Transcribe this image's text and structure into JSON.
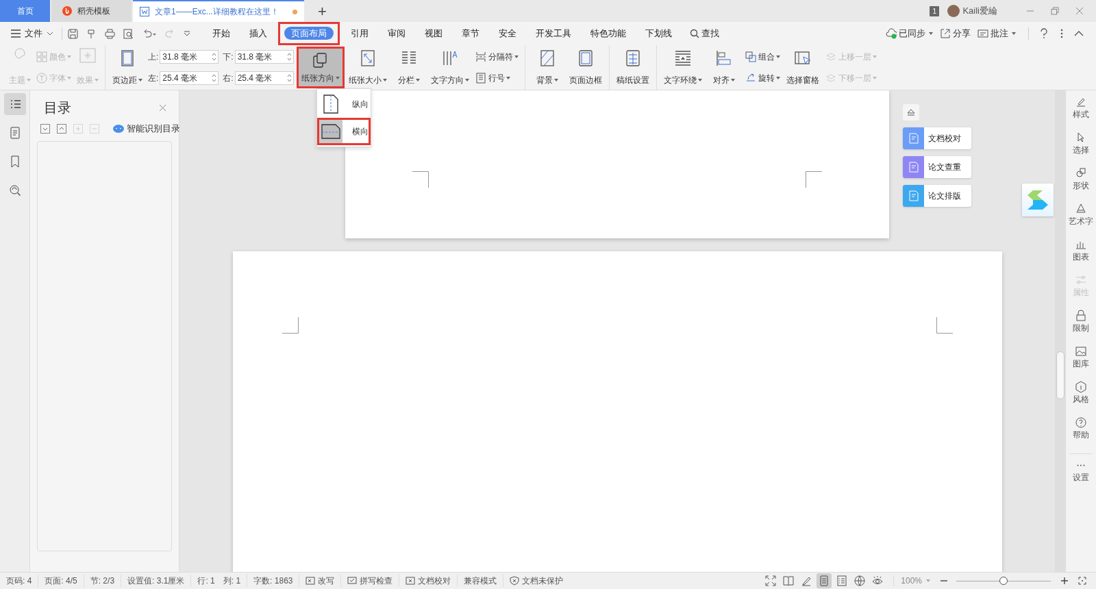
{
  "tabs": [
    {
      "kind": "home",
      "label": "首页",
      "selected": false
    },
    {
      "kind": "template",
      "label": "稻壳模板",
      "selected": false
    },
    {
      "kind": "document",
      "label": "文章1——Exc...详细教程在这里！",
      "selected": true,
      "modified": true
    }
  ],
  "titlebar": {
    "new_tab": "+",
    "badge": "1",
    "user": "Kaili爱綸"
  },
  "menu": {
    "file": "文件",
    "items": [
      {
        "label": "开始",
        "selected": false,
        "highlighted": false
      },
      {
        "label": "插入",
        "selected": false,
        "highlighted": false
      },
      {
        "label": "页面布局",
        "selected": true,
        "highlighted": true
      },
      {
        "label": "引用",
        "selected": false,
        "highlighted": false
      },
      {
        "label": "审阅",
        "selected": false,
        "highlighted": false
      },
      {
        "label": "视图",
        "selected": false,
        "highlighted": false
      },
      {
        "label": "章节",
        "selected": false,
        "highlighted": false
      },
      {
        "label": "安全",
        "selected": false,
        "highlighted": false
      },
      {
        "label": "开发工具",
        "selected": false,
        "highlighted": false
      },
      {
        "label": "特色功能",
        "selected": false,
        "highlighted": false
      },
      {
        "label": "下划线",
        "selected": false,
        "highlighted": false
      }
    ],
    "search": "查找",
    "right": [
      {
        "label": "已同步",
        "dropdown": true
      },
      {
        "label": "分享",
        "dropdown": false
      },
      {
        "label": "批注",
        "dropdown": true
      }
    ]
  },
  "ribbon": {
    "groups": [
      [
        {
          "kind": "stack",
          "items": [
            {
              "label": "主题",
              "dropdown": true,
              "disabled": true
            }
          ]
        },
        {
          "kind": "stack",
          "items": [
            {
              "label": "颜色",
              "dropdown": true,
              "disabled": true
            },
            {
              "label": "字体",
              "dropdown": true,
              "disabled": true
            }
          ]
        },
        {
          "kind": "stack",
          "items": [
            {
              "label": "效果",
              "dropdown": true,
              "disabled": true
            }
          ]
        }
      ],
      [
        {
          "kind": "large",
          "label": "页边距",
          "dropdown": true,
          "disabled": false,
          "active": false,
          "highlighted": false
        },
        {
          "kind": "fields",
          "items": [
            {
              "label": "上:",
              "value": "31.8 毫米"
            },
            {
              "label": "左:",
              "value": "25.4 毫米"
            }
          ]
        },
        {
          "kind": "fields",
          "items": [
            {
              "label": "下:",
              "value": "31.8 毫米"
            },
            {
              "label": "右:",
              "value": "25.4 毫米"
            }
          ]
        },
        {
          "kind": "large",
          "label": "纸张方向",
          "dropdown": true,
          "disabled": false,
          "active": true,
          "highlighted": true
        },
        {
          "kind": "large",
          "label": "纸张大小",
          "dropdown": true,
          "disabled": false,
          "active": false,
          "highlighted": false
        },
        {
          "kind": "large",
          "label": "分栏",
          "dropdown": true,
          "disabled": false,
          "active": false,
          "highlighted": false
        },
        {
          "kind": "large",
          "label": "文字方向",
          "dropdown": true,
          "disabled": false,
          "active": false,
          "highlighted": false
        },
        {
          "kind": "stack",
          "items": [
            {
              "label": "分隔符",
              "dropdown": true,
              "disabled": false
            },
            {
              "label": "行号",
              "dropdown": true,
              "disabled": false
            }
          ]
        }
      ],
      [
        {
          "kind": "large",
          "label": "背景",
          "dropdown": true,
          "disabled": false,
          "active": false,
          "highlighted": false
        },
        {
          "kind": "large",
          "label": "页面边框",
          "dropdown": false,
          "disabled": false,
          "active": false,
          "highlighted": false
        }
      ],
      [
        {
          "kind": "large",
          "label": "稿纸设置",
          "dropdown": false,
          "disabled": false,
          "active": false,
          "highlighted": false
        }
      ],
      [
        {
          "kind": "large",
          "label": "文字环绕",
          "dropdown": true,
          "disabled": false,
          "active": false,
          "highlighted": false
        },
        {
          "kind": "large",
          "label": "对齐",
          "dropdown": true,
          "disabled": false,
          "active": false,
          "highlighted": false
        },
        {
          "kind": "stack",
          "items": [
            {
              "label": "组合",
              "dropdown": true,
              "disabled": false
            },
            {
              "label": "旋转",
              "dropdown": true,
              "disabled": false
            }
          ]
        },
        {
          "kind": "large",
          "label": "选择窗格",
          "dropdown": false,
          "disabled": false,
          "active": false,
          "highlighted": false
        },
        {
          "kind": "stack",
          "items": [
            {
              "label": "上移一层",
              "dropdown": true,
              "disabled": true
            },
            {
              "label": "下移一层",
              "dropdown": true,
              "disabled": true
            }
          ]
        }
      ]
    ]
  },
  "orientation_menu": [
    {
      "label": "纵向",
      "selected": false,
      "highlighted": false
    },
    {
      "label": "横向",
      "selected": true,
      "highlighted": true
    }
  ],
  "left_strip": [
    {
      "selected": true
    },
    {
      "selected": false
    },
    {
      "selected": false
    },
    {
      "selected": false
    }
  ],
  "toc": {
    "title": "目录",
    "smart": "智能识别目录",
    "buttons": [
      {
        "disabled": false
      },
      {
        "disabled": false
      },
      {
        "disabled": true
      },
      {
        "disabled": true
      }
    ]
  },
  "float_tools": [
    {
      "label": "文档校对",
      "color": "#6b9cf7"
    },
    {
      "label": "论文查重",
      "color": "#8f86f5"
    },
    {
      "label": "论文排版",
      "color": "#3ea8ef"
    }
  ],
  "right_sidebar": [
    {
      "label": "样式",
      "disabled": false
    },
    {
      "label": "选择",
      "disabled": false
    },
    {
      "label": "形状",
      "disabled": false
    },
    {
      "label": "艺术字",
      "disabled": false
    },
    {
      "label": "图表",
      "disabled": false
    },
    {
      "label": "属性",
      "disabled": true
    },
    {
      "label": "限制",
      "disabled": false
    },
    {
      "label": "图库",
      "disabled": false
    },
    {
      "label": "风格",
      "disabled": false
    },
    {
      "label": "帮助",
      "disabled": false
    },
    {
      "label": "设置",
      "disabled": false
    }
  ],
  "status_bar": {
    "items": [
      {
        "kind": "text",
        "label": "页码: 4"
      },
      {
        "kind": "text",
        "label": "页面: 4/5"
      },
      {
        "kind": "text",
        "label": "节: 2/3"
      },
      {
        "kind": "text",
        "label": "设置值: 3.1厘米"
      },
      {
        "kind": "text",
        "label": "行: 1"
      },
      {
        "kind": "text",
        "label": "列: 1"
      },
      {
        "kind": "text",
        "label": "字数: 1863"
      },
      {
        "kind": "button",
        "label": "改写"
      },
      {
        "kind": "button",
        "label": "拼写检查"
      },
      {
        "kind": "button",
        "label": "文档校对"
      },
      {
        "kind": "text",
        "label": "兼容模式"
      },
      {
        "kind": "button",
        "label": "文档未保护"
      }
    ],
    "views": [
      {
        "selected": false
      },
      {
        "selected": false
      },
      {
        "selected": false
      },
      {
        "selected": true
      },
      {
        "selected": false
      },
      {
        "selected": false
      },
      {
        "selected": false
      }
    ],
    "zoom": {
      "label": "100%",
      "level": 0.5
    }
  }
}
